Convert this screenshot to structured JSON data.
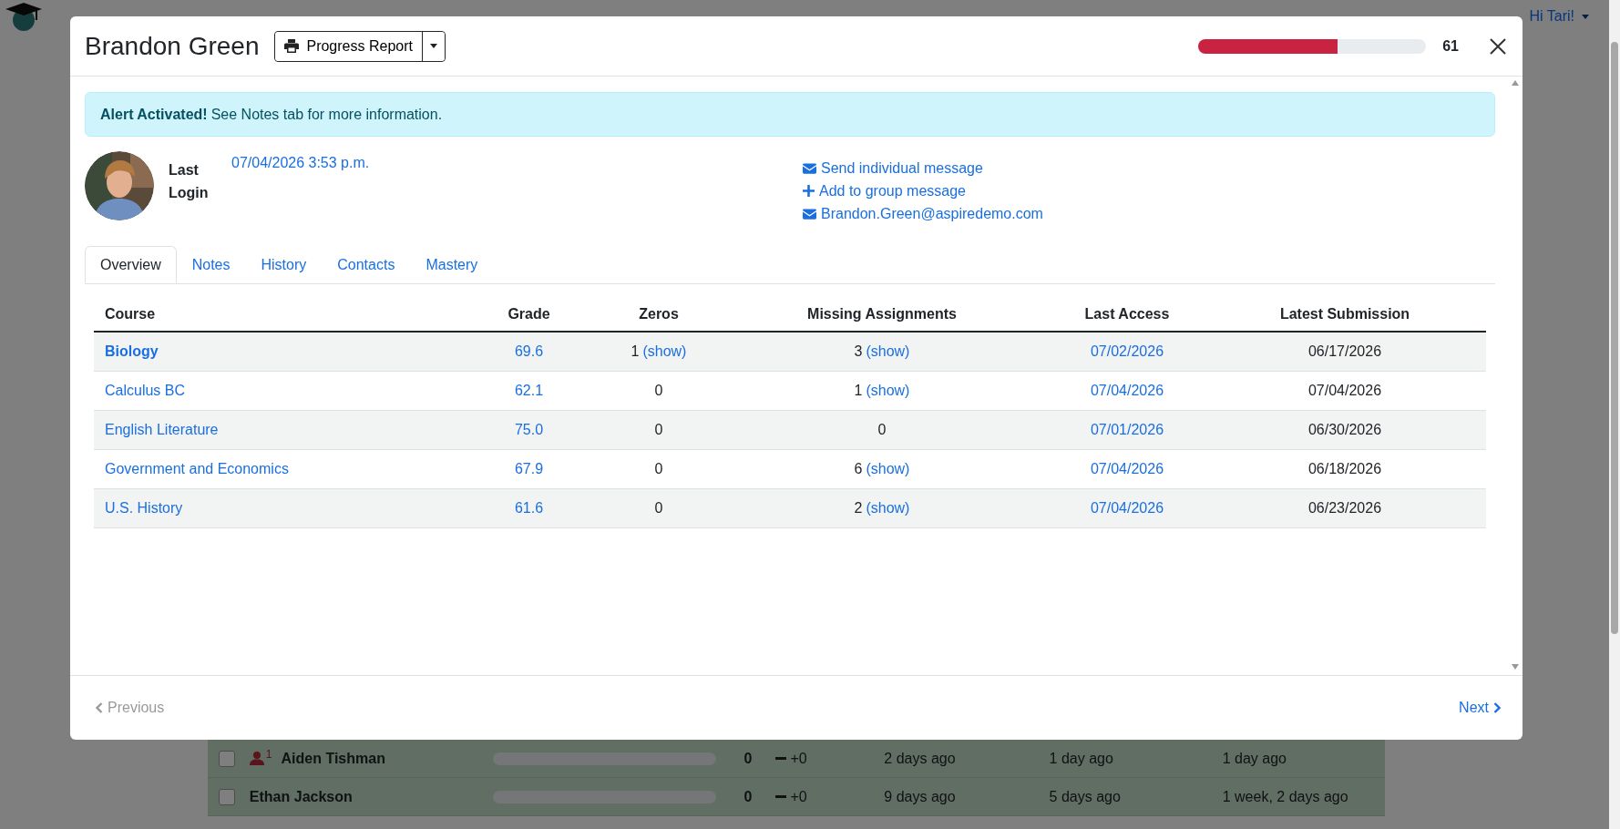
{
  "navbar": {
    "user": "Hi Tari!"
  },
  "background_rows": [
    {
      "name": "Aiden Tishman",
      "checked": false,
      "flag_count": "1",
      "level": 0,
      "score": "0",
      "change": "+0",
      "column_5": "2 days ago",
      "column_6": "1 day ago",
      "column_7": "1 day ago"
    },
    {
      "name": "Ethan Jackson",
      "checked": false,
      "level": 0,
      "score": "0",
      "change": "+0",
      "column_5": "9 days ago",
      "column_6": "5 days ago",
      "column_7": "1 week, 2 days ago"
    }
  ],
  "modal": {
    "title": "Brandon Green",
    "report_button": "Progress Report",
    "level": 0.61,
    "score": "61",
    "alert": "**Alert Activated!** See Notes tab for more information.",
    "last_login_label": "Last Login",
    "last_login": "07/04/2026 3:53 p.m.",
    "actions": [
      {
        "kind": "envelope",
        "label": "Send individual message"
      },
      {
        "kind": "plus",
        "label": "Add to group message"
      },
      {
        "kind": "envelope",
        "label": "Brandon.Green@aspiredemo.com"
      }
    ],
    "tabs": [
      {
        "label": "Overview",
        "selected": true
      },
      {
        "label": "Notes",
        "selected": false
      },
      {
        "label": "History",
        "selected": false
      },
      {
        "label": "Contacts",
        "selected": false
      },
      {
        "label": "Mastery",
        "selected": false
      }
    ],
    "table": {
      "columns": [
        "Course",
        "Grade",
        "Zeros",
        "Missing Assignments",
        "Last Access",
        "Latest Submission"
      ],
      "rows": [
        {
          "course": "Biology",
          "bold": true,
          "grade": "69.6",
          "zeros": {
            "count": "1",
            "show": "(show)"
          },
          "missing": {
            "count": "3",
            "show": "(show)"
          },
          "last_access": "07/02/2026",
          "latest_submission": "06/17/2026"
        },
        {
          "course": "Calculus BC",
          "bold": false,
          "grade": "62.1",
          "zeros": {
            "count": "0"
          },
          "missing": {
            "count": "1",
            "show": "(show)"
          },
          "last_access": "07/04/2026",
          "latest_submission": "07/04/2026"
        },
        {
          "course": "English Literature",
          "bold": false,
          "grade": "75.0",
          "zeros": {
            "count": "0"
          },
          "missing": {
            "count": "0"
          },
          "last_access": "07/01/2026",
          "latest_submission": "06/30/2026"
        },
        {
          "course": "Government and Economics",
          "bold": false,
          "grade": "67.9",
          "zeros": {
            "count": "0"
          },
          "missing": {
            "count": "6",
            "show": "(show)"
          },
          "last_access": "07/04/2026",
          "latest_submission": "06/18/2026"
        },
        {
          "course": "U.S. History",
          "bold": false,
          "grade": "61.6",
          "zeros": {
            "count": "0"
          },
          "missing": {
            "count": "2",
            "show": "(show)"
          },
          "last_access": "07/04/2026",
          "latest_submission": "06/23/2026"
        }
      ]
    },
    "footer": {
      "previous": {
        "label": "Previous",
        "disabled": true
      },
      "next": {
        "label": "Next",
        "disabled": false
      }
    }
  }
}
